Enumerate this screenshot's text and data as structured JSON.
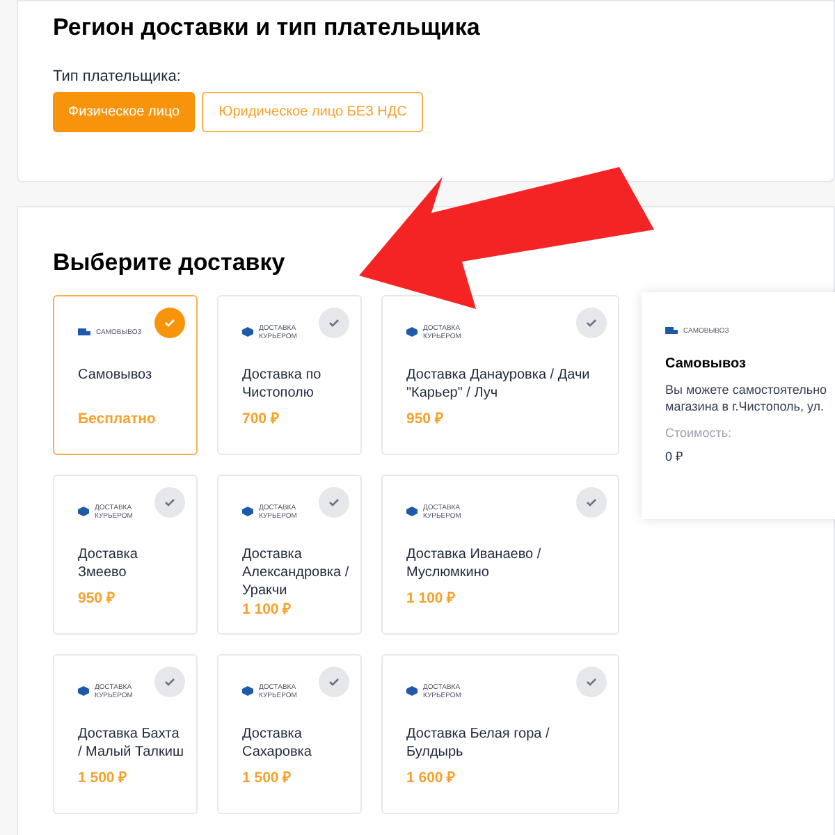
{
  "region_section": {
    "title": "Регион доставки и тип плательщика",
    "payer_label": "Тип плательщика:",
    "payer_types": [
      {
        "label": "Физическое лицо",
        "selected": true
      },
      {
        "label": "Юридическое лицо БЕЗ НДС",
        "selected": false
      }
    ]
  },
  "delivery_section": {
    "title": "Выберите доставку",
    "options": [
      {
        "logo": {
          "kind": "pickup",
          "text": "САМОВЫВОЗ"
        },
        "name": "Самовывоз",
        "price": "Бесплатно",
        "selected": true
      },
      {
        "logo": {
          "kind": "courier",
          "text": "ДОСТАВКА КУРЬЕРОМ"
        },
        "name": "Доставка по Чистополю",
        "price": "700 ₽",
        "selected": false
      },
      {
        "logo": {
          "kind": "courier",
          "text": "ДОСТАВКА КУРЬЕРОМ"
        },
        "name": "Доставка Данауровка / Дачи \"Карьер\" / Луч",
        "price": "950 ₽",
        "selected": false
      },
      {
        "logo": {
          "kind": "courier",
          "text": "ДОСТАВКА КУРЬЕРОМ"
        },
        "name": "Доставка Змеево",
        "price": "950 ₽",
        "selected": false
      },
      {
        "logo": {
          "kind": "courier",
          "text": "ДОСТАВКА КУРЬЕРОМ"
        },
        "name": "Доставка Александровка / Уракчи",
        "price": "1 100 ₽",
        "selected": false
      },
      {
        "logo": {
          "kind": "courier",
          "text": "ДОСТАВКА КУРЬЕРОМ"
        },
        "name": "Доставка Иванаево / Муслюмкино",
        "price": "1 100 ₽",
        "selected": false
      },
      {
        "logo": {
          "kind": "courier",
          "text": "ДОСТАВКА КУРЬЕРОМ"
        },
        "name": "Доставка Бахта / Малый Талкиш",
        "price": "1 500 ₽",
        "selected": false
      },
      {
        "logo": {
          "kind": "courier",
          "text": "ДОСТАВКА КУРЬЕРОМ"
        },
        "name": "Доставка Сахаровка",
        "price": "1 500 ₽",
        "selected": false
      },
      {
        "logo": {
          "kind": "courier",
          "text": "ДОСТАВКА КУРЬЕРОМ"
        },
        "name": "Доставка Белая гора / Булдырь",
        "price": "1 600 ₽",
        "selected": false
      }
    ],
    "details": {
      "logo": {
        "kind": "pickup",
        "text": "САМОВЫВОЗ"
      },
      "title": "Самовывоз",
      "description_lines": [
        "Вы можете самостоятельно",
        "магазина в г.Чистополь, ул."
      ],
      "cost_label": "Стоимость:",
      "cost": "0 ₽"
    }
  }
}
